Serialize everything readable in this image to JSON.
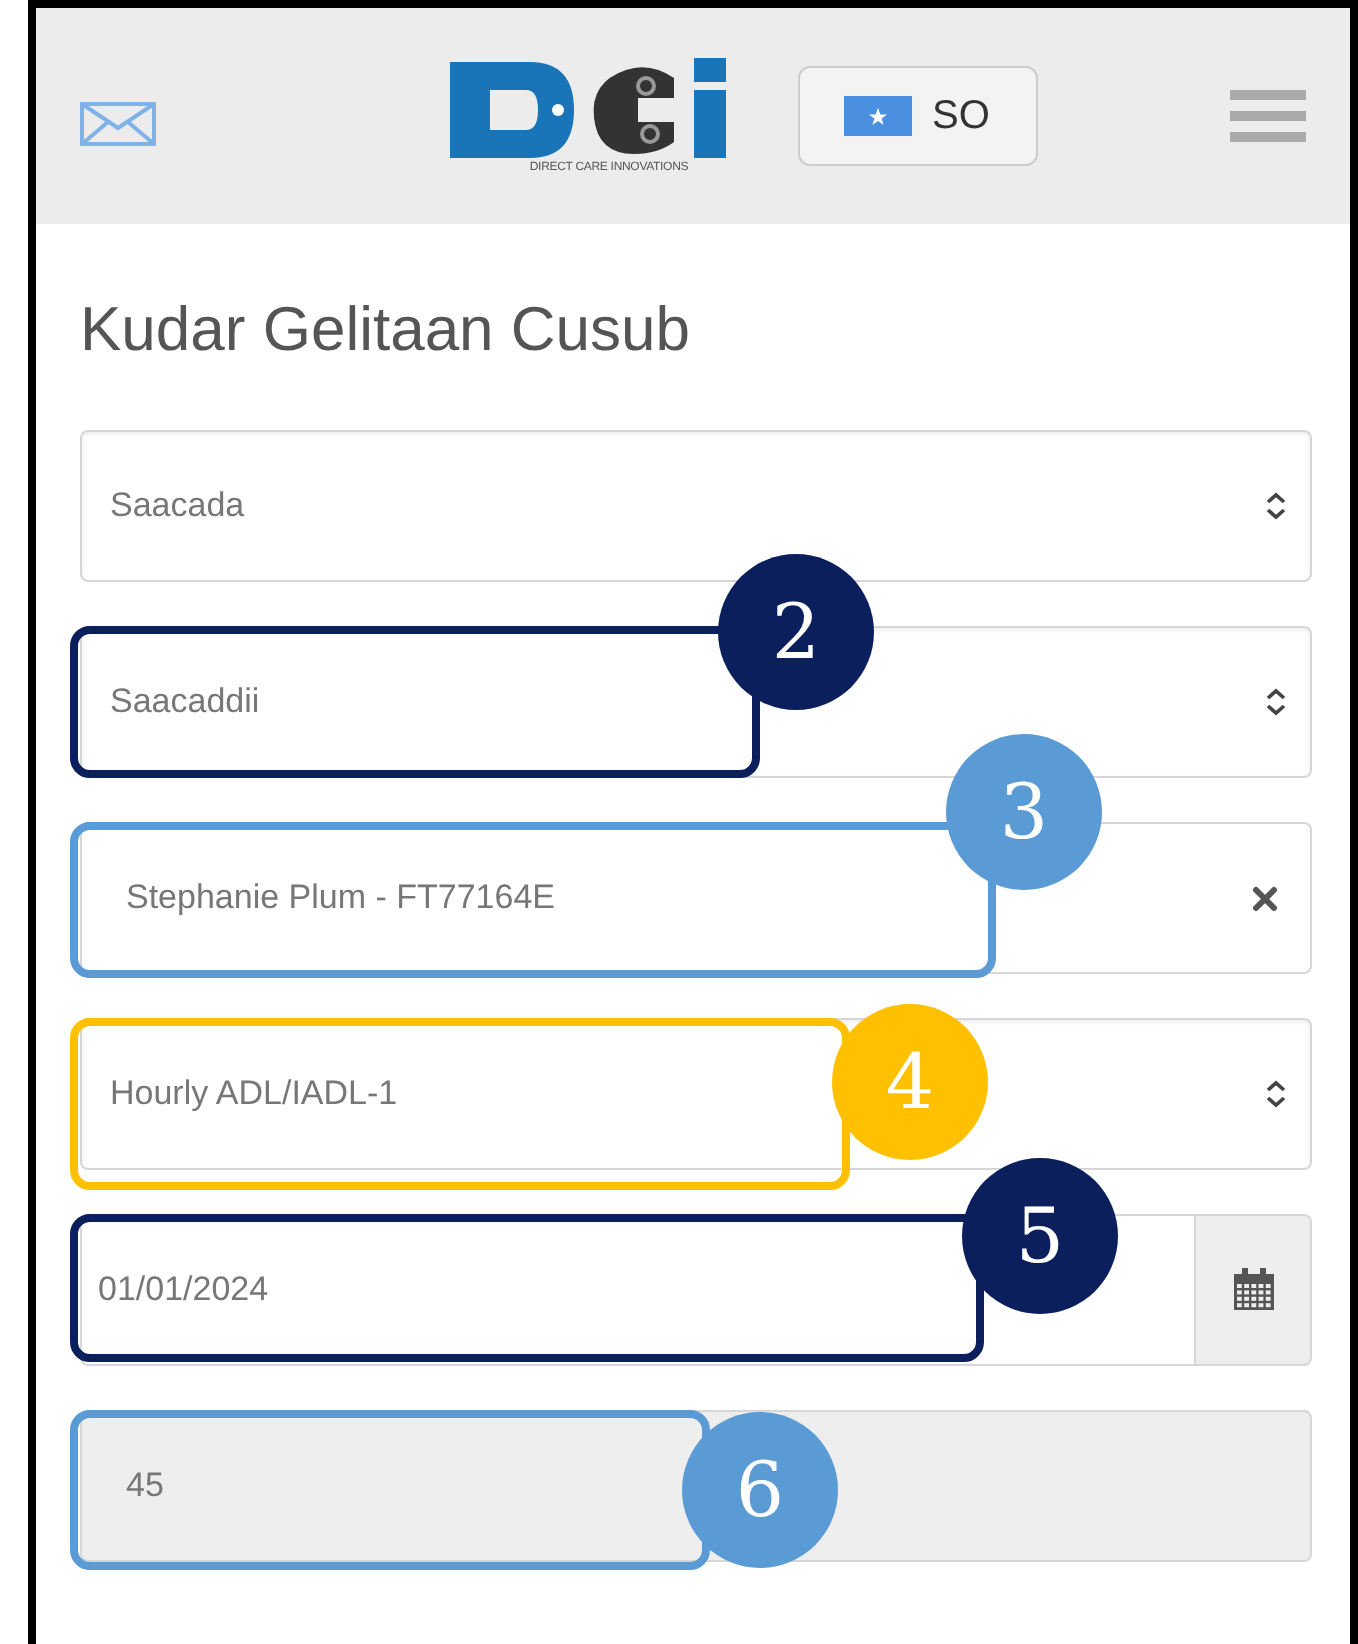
{
  "header": {
    "logo_tagline": "DIRECT CARE INNOVATIONS",
    "language": "SO"
  },
  "title": "Kudar Gelitaan Cusub",
  "fields": [
    {
      "kind": "select",
      "placeholder": "Saacada"
    },
    {
      "kind": "select",
      "placeholder": "Saacaddii",
      "callout": {
        "number": "2",
        "color": "#0b1f5c"
      }
    },
    {
      "kind": "clearable",
      "value": "Stephanie Plum - FT77164E",
      "callout": {
        "number": "3",
        "color": "#5b9bd5"
      }
    },
    {
      "kind": "select",
      "value": "Hourly ADL/IADL-1",
      "callout": {
        "number": "4",
        "color": "#ffc000"
      }
    },
    {
      "kind": "date",
      "value": "01/01/2024",
      "callout": {
        "number": "5",
        "color": "#0b1f5c"
      }
    },
    {
      "kind": "disabled",
      "value": "45",
      "callout": {
        "number": "6",
        "color": "#5b9bd5"
      }
    }
  ]
}
